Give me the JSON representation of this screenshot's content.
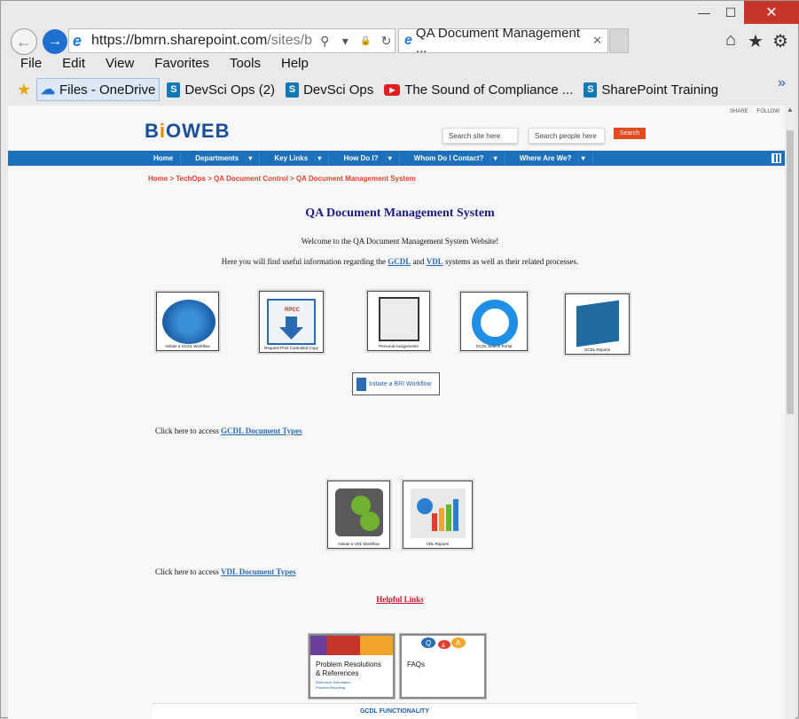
{
  "window": {
    "min_glyph": "—",
    "max_glyph": "☐",
    "close_glyph": "✕"
  },
  "nav": {
    "back_glyph": "←",
    "forward_glyph": "→"
  },
  "address": {
    "url_host": "https://bmrn.sharepoint.com",
    "url_path": "/sites/biowe",
    "search_glyph": "⚲",
    "dropdown_glyph": "▾",
    "lock_glyph": "🔒",
    "refresh_glyph": "↻",
    "ie_glyph": "e"
  },
  "tab": {
    "title": "QA Document Management ...",
    "close_glyph": "✕"
  },
  "toolbar_icons": {
    "home": "⌂",
    "favorites": "★",
    "settings": "⚙"
  },
  "menu": [
    "File",
    "Edit",
    "View",
    "Favorites",
    "Tools",
    "Help"
  ],
  "favorites": [
    {
      "label": "Files - OneDrive",
      "icon": "onedrive-icon",
      "glyph": "☁",
      "selected": true
    },
    {
      "label": "DevSci Ops (2)",
      "icon": "sharepoint-icon",
      "glyph": "S"
    },
    {
      "label": "DevSci Ops",
      "icon": "sharepoint-icon",
      "glyph": "S"
    },
    {
      "label": "The Sound of Compliance ...",
      "icon": "youtube-icon",
      "glyph": "▶"
    },
    {
      "label": "SharePoint Training",
      "icon": "sharepoint-icon",
      "glyph": "S"
    }
  ],
  "fav_more": "»",
  "site": {
    "share": "SHARE",
    "follow": "FOLLOW",
    "logo_pre": "B",
    "logo_accent": "i",
    "logo_post": "OWEB",
    "search_site": "Search site here",
    "search_people": "Search people here",
    "search_btn": "Search",
    "nav": [
      "Home",
      "Departments",
      "Key Links",
      "How Do I?",
      "Whom Do I Contact?",
      "Where Are We?"
    ],
    "nav_dropdown": [
      false,
      true,
      true,
      true,
      true,
      true
    ],
    "breadcrumb": "Home > TechOps > QA Document Control > QA Document Management System",
    "title": "QA Document Management System",
    "welcome": "Welcome to the QA Document Management System Website!",
    "intro_pre": "Here you will find useful information regarding the ",
    "intro_gcdl": "GCDL",
    "intro_and": " and ",
    "intro_vdl": "VDL",
    "intro_post": " systems as well as their related processes.",
    "tiles_gcdl": [
      "Initiate a GCDL Workflow",
      "Request Print Controlled Copy",
      "Personal Assignments",
      "GCDL Search Portal",
      "GCDL Reports"
    ],
    "rpcc_label": "RPCC",
    "bri": "Initiate a BRI Workflow",
    "gcdl_types_pre": "Click here to access ",
    "gcdl_types_link": "GCDL Document Types",
    "tiles_vdl": [
      "Initiate a VDL Workflow",
      "VDL Reports"
    ],
    "vdl_types_pre": "Click here to access ",
    "vdl_types_link": "VDL Document Types",
    "helpful": "Helpful Links",
    "card1_title1": "Problem Resolutions",
    "card1_title2": "& References",
    "card1_sub1": "Reference Information",
    "card1_sub2": "Problem Reporting",
    "card2_title": "FAQs",
    "card2_q": "Q",
    "card2_amp": "&",
    "card2_a": "A",
    "gcdl_func": "GCDL FUNCTIONALITY"
  }
}
